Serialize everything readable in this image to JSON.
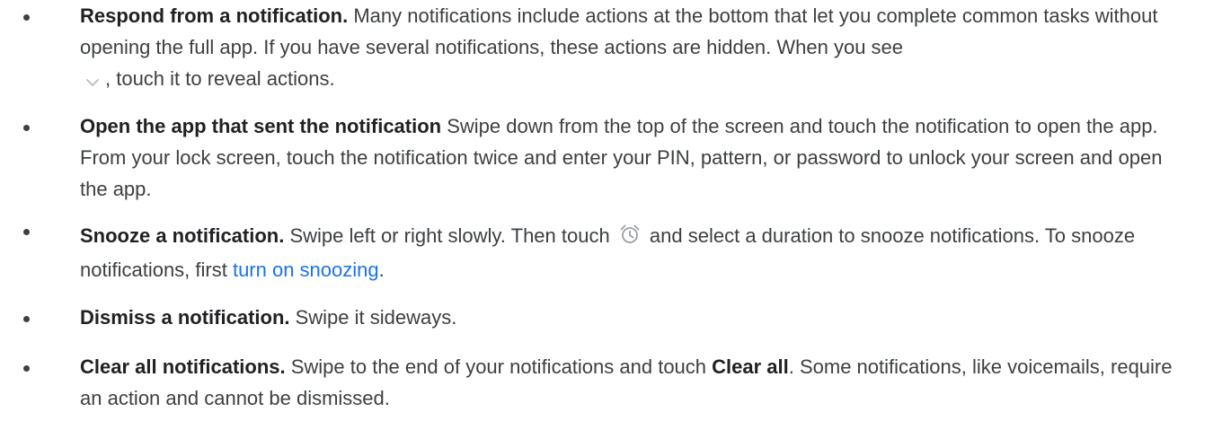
{
  "items": [
    {
      "title": "Respond from a notification.",
      "text_before": " Many notifications include actions at the bottom that let you complete common tasks without opening the full app. If you have several notifications, these actions are hidden. When you see ",
      "icon": "chevron-down-icon",
      "text_after": ", touch it to reveal actions."
    },
    {
      "title": "Open the app that sent the notification",
      "text": " Swipe down from the top of the screen and touch the notification to open the app. From your lock screen, touch the notification twice and enter your PIN, pattern, or password to unlock your screen and open the app."
    },
    {
      "title": "Snooze a notification.",
      "text_before": " Swipe left or right slowly. Then touch ",
      "icon": "alarm-clock-icon",
      "text_middle": " and select a duration to snooze notifications. To snooze notifications, first ",
      "link_text": "turn on snoozing",
      "text_after": "."
    },
    {
      "title": "Dismiss a notification.",
      "text": " Swipe it sideways."
    },
    {
      "title": "Clear all notifications.",
      "text_before": " Swipe to the end of your notifications and touch ",
      "bold_inline": "Clear all",
      "text_after": ". Some notifications, like voicemails, require an action and cannot be dismissed."
    }
  ],
  "colors": {
    "text": "#3c4043",
    "bold": "#202124",
    "link": "#1a73e8",
    "icon": "#9aa0a6"
  }
}
